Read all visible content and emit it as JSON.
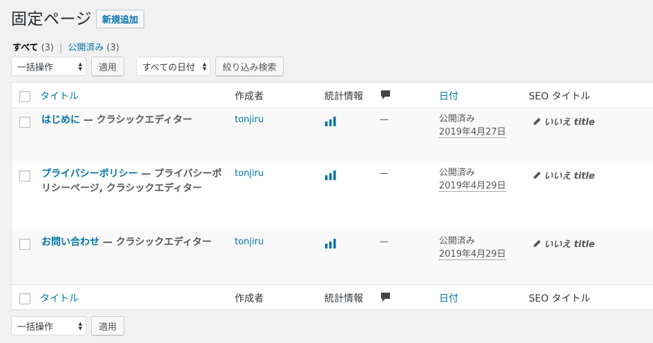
{
  "header": {
    "title": "固定ページ",
    "add_new": "新規追加"
  },
  "filters": {
    "all_label": "すべて",
    "all_count": "(3)",
    "separator": "|",
    "published_label": "公開済み",
    "published_count": "(3)"
  },
  "top_controls": {
    "bulk_action": "一括操作",
    "apply": "適用",
    "date_filter": "すべての日付",
    "filter_button": "絞り込み検索"
  },
  "columns": {
    "title": "タイトル",
    "author": "作成者",
    "stats": "統計情報",
    "comments_icon": "comment-bubble-icon",
    "date": "日付",
    "seo_title": "SEO タイトル"
  },
  "rows": [
    {
      "title": "はじめに",
      "suffix": " — クラシックエディター",
      "author": "tonjiru",
      "comments": "—",
      "status": "公開済み",
      "date": "2019年4月27日",
      "seo": "いいえ title"
    },
    {
      "title": "プライバシーポリシー",
      "suffix": " — プライバシーポリシーページ, クラシックエディター",
      "author": "tonjiru",
      "comments": "—",
      "status": "公開済み",
      "date": "2019年4月29日",
      "seo": "いいえ title"
    },
    {
      "title": "お問い合わせ",
      "suffix": " — クラシックエディター",
      "author": "tonjiru",
      "comments": "—",
      "status": "公開済み",
      "date": "2019年4月29日",
      "seo": "いいえ title"
    }
  ],
  "bottom_controls": {
    "bulk_action": "一括操作",
    "apply": "適用"
  },
  "colors": {
    "link": "#0073aa",
    "stats_bar": "#0073aa"
  }
}
